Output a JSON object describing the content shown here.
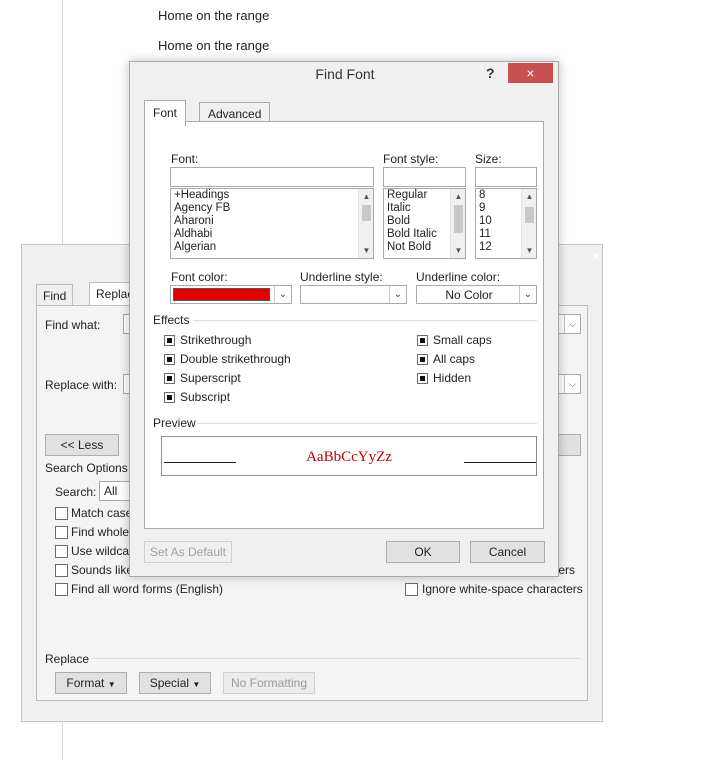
{
  "document": {
    "lines": [
      "Home on the range",
      "Home on the range"
    ]
  },
  "find_replace": {
    "close_icon": "×",
    "tabs": [
      "Find",
      "Replac"
    ],
    "find_what_label": "Find what:",
    "replace_with_label": "Replace with:",
    "less_button": "<< Less",
    "search_options_label": "Search Options",
    "search_label": "Search:",
    "search_value": "All",
    "options_left": [
      "Match case",
      "Find whole",
      "Use wildcar",
      "Sounds like",
      "Find all word forms (English)"
    ],
    "options_right_partial": "ters",
    "ignore_whitespace": "Ignore white-space characters",
    "replace_section_label": "Replace",
    "format_button": "Format",
    "special_button": "Special",
    "no_formatting_button": "No Formatting"
  },
  "find_font": {
    "title": "Find Font",
    "help_icon": "?",
    "close_icon": "×",
    "tabs": {
      "font": "Font",
      "advanced": "Advanced"
    },
    "font_label": "Font:",
    "font_input_value": "",
    "font_list": [
      "+Headings",
      "Agency FB",
      "Aharoni",
      "Aldhabi",
      "Algerian"
    ],
    "style_label": "Font style:",
    "style_input_value": "",
    "style_list": [
      "Regular",
      "Italic",
      "Bold",
      "Bold Italic",
      "Not Bold"
    ],
    "size_label": "Size:",
    "size_input_value": "",
    "size_list": [
      "8",
      "9",
      "10",
      "11",
      "12"
    ],
    "font_color_label": "Font color:",
    "font_color_value": "#e00000",
    "underline_style_label": "Underline style:",
    "underline_style_value": "",
    "underline_color_label": "Underline color:",
    "underline_color_value": "No Color",
    "effects_label": "Effects",
    "effects_left": [
      "Strikethrough",
      "Double strikethrough",
      "Superscript",
      "Subscript"
    ],
    "effects_right": [
      "Small caps",
      "All caps",
      "Hidden"
    ],
    "preview_label": "Preview",
    "preview_text": "AaBbCcYyZz",
    "set_default_button": "Set As Default",
    "ok_button": "OK",
    "cancel_button": "Cancel",
    "close_color": "#c75050",
    "preview_color": "#c00000"
  }
}
